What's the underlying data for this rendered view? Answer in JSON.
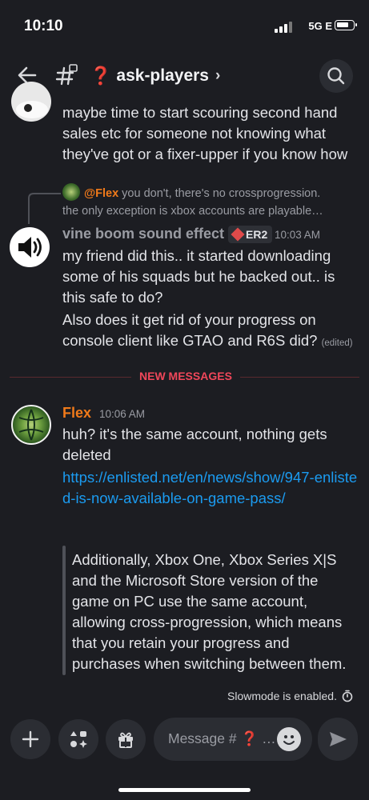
{
  "status_bar": {
    "time": "10:10",
    "network": "5G E"
  },
  "header": {
    "channel_name": "ask-players",
    "channel_emoji": "❓"
  },
  "messages": {
    "prev_text": "maybe time to start scouring second hand sales etc for someone not knowing what they've got or a fixer-upper if you know how",
    "reply": {
      "mention": "@Flex",
      "text_line1": " you don't, there's no crossprogression.",
      "text_line2": "the only exception is xbox accounts are playable…"
    },
    "vine": {
      "author": "vine boom sound effect",
      "tag": "ER2",
      "time": "10:03 AM",
      "text1": "my friend did this.. it started downloading some of his squads but he backed out.. is this safe to do?",
      "text2": "Also does it get rid of your progress on console client like GTAO and R6S did?",
      "edited": "(edited)"
    },
    "new_messages_label": "NEW MESSAGES",
    "flex": {
      "author": "Flex",
      "time": "10:06 AM",
      "text": "huh? it's the same account, nothing gets deleted",
      "link": "https://enlisted.net/en/news/show/947-enlisted-is-now-available-on-game-pass/",
      "quote": "Additionally, Xbox One, Xbox Series X|S and the Microsoft Store version of the game on PC use the same account, allowing cross-progression, which means that you retain your progress and purchases when switching between them."
    }
  },
  "slowmode": "Slowmode is enabled.",
  "composer": {
    "placeholder_prefix": "Message # ",
    "placeholder_emoji": "❓",
    "placeholder_suffix": " …"
  },
  "colors": {
    "background": "#1c1d22",
    "flex_name": "#f07a1a",
    "link": "#1b9bf0",
    "new_messages": "#f0475a",
    "vine_name": "#9a9ca3"
  }
}
